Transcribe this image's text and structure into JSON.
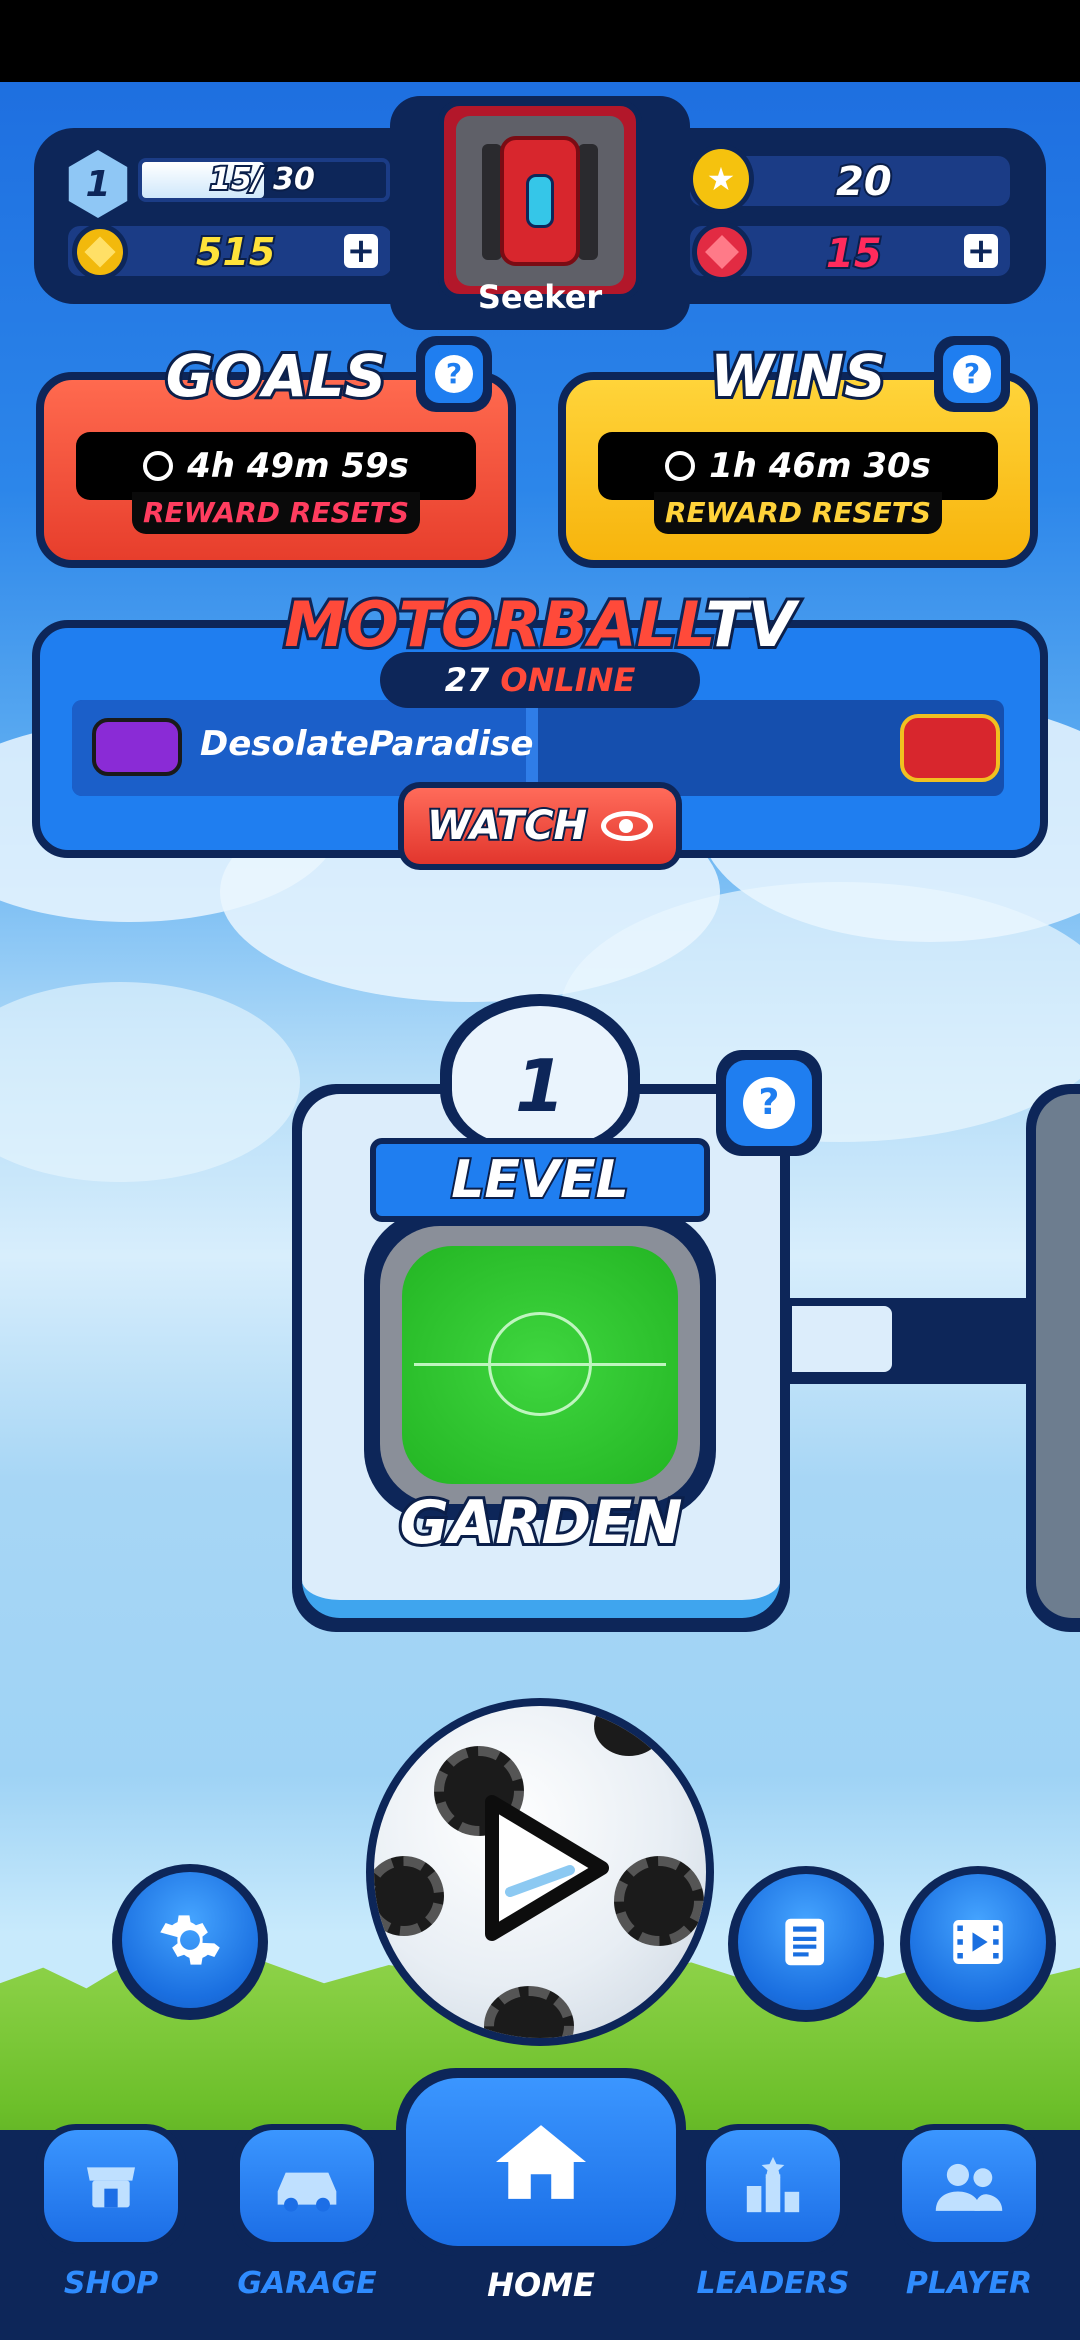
{
  "player": {
    "level": "1",
    "xp_text": "15/ 30",
    "xp_fraction": 0.5,
    "gold": "515",
    "medals": "20",
    "gems": "15",
    "vehicle_name": "Seeker"
  },
  "goals": {
    "title": "GOALS",
    "timer": "4h 49m 59s",
    "reset_label": "REWARD RESETS"
  },
  "wins": {
    "title": "WINS",
    "timer": "1h 46m 30s",
    "reset_label": "REWARD RESETS"
  },
  "tv": {
    "title_main": "MOTORBALL",
    "title_suffix": "TV",
    "online_count": "27",
    "online_label": "ONLINE",
    "streamer": "DesolateParadise",
    "watch_label": "WATCH"
  },
  "level_card": {
    "number": "1",
    "ribbon": "LEVEL",
    "arena_name": "GARDEN"
  },
  "nav": {
    "shop": "SHOP",
    "garage": "GARAGE",
    "home": "HOME",
    "leaders": "LEADERS",
    "player": "PLAYER"
  },
  "icons": {
    "settings": "gear-icon",
    "news": "news-icon",
    "video": "video-icon",
    "play": "play-icon"
  },
  "colors": {
    "navy": "#0d2659",
    "goals_card": "#ee4b35",
    "wins_card": "#fbc21c",
    "tv_blue": "#1f7ef0",
    "reset_goals": "#ff3d5f",
    "reset_wins": "#ffd23a",
    "gold_text": "#ffe23a",
    "gem_text": "#ff2b5c"
  }
}
